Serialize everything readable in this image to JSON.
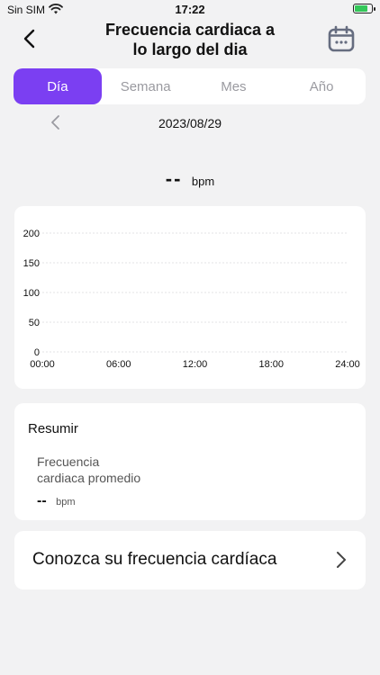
{
  "status_bar": {
    "carrier": "Sin SIM",
    "time": "17:22"
  },
  "header": {
    "title_line1": "Frecuencia cardiaca a",
    "title_line2": "lo largo del dia"
  },
  "tabs": [
    {
      "label": "Día",
      "active": true
    },
    {
      "label": "Semana",
      "active": false
    },
    {
      "label": "Mes",
      "active": false
    },
    {
      "label": "Año",
      "active": false
    }
  ],
  "date": "2023/08/29",
  "current": {
    "value": "--",
    "unit": "bpm"
  },
  "chart_data": {
    "type": "line",
    "x_tick_labels": [
      "00:00",
      "06:00",
      "12:00",
      "18:00",
      "24:00"
    ],
    "y_tick_labels": [
      "200",
      "150",
      "100",
      "50",
      "0"
    ],
    "ylim": [
      0,
      200
    ],
    "series": [],
    "grid": true
  },
  "summary": {
    "title": "Resumir",
    "label_line1": "Frecuencia",
    "label_line2": "cardiaca promedio",
    "value": "--",
    "unit": "bpm"
  },
  "info_link": {
    "label": "Conozca su frecuencia cardíaca"
  },
  "colors": {
    "accent": "#7b3ff2",
    "battery": "#34c759"
  },
  "icons": {
    "back": "chevron-left-icon",
    "calendar": "calendar-icon",
    "prev": "chevron-left-icon",
    "forward": "chevron-right-icon"
  }
}
